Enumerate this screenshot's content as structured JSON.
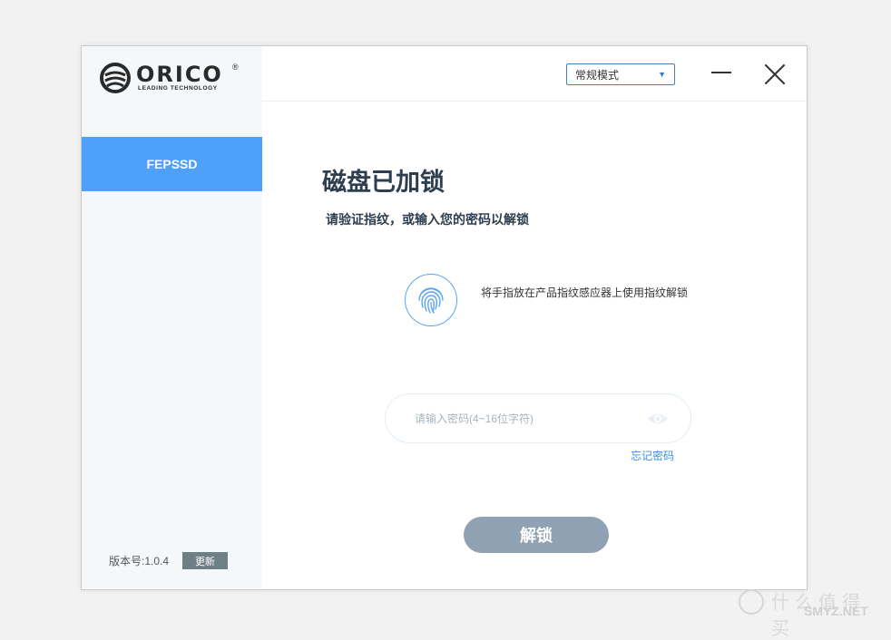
{
  "brand": {
    "name": "ORICO",
    "registered": "®",
    "tagline": "LEADING TECHNOLOGY"
  },
  "sidebar": {
    "items": [
      {
        "label": "FEPSSD"
      }
    ],
    "version_label": "版本号:1.0.4",
    "update_label": "更新"
  },
  "toolbar": {
    "mode_value": "常规模式",
    "mode_icon": "chevron-down-icon"
  },
  "main": {
    "title": "磁盘已加锁",
    "subtitle": "请验证指纹，或输入您的密码以解锁",
    "fingerprint_hint": "将手指放在产品指纹感应器上使用指纹解锁",
    "password_placeholder": "请输入密码(4~16位字符)",
    "password_value": "",
    "forgot_label": "忘记密码",
    "unlock_label": "解锁"
  },
  "watermark": {
    "top": "什么值得买",
    "bottom": "SMYZ.NET"
  },
  "colors": {
    "accent": "#4ea0f8",
    "sidebar_bg": "#f5f8fa",
    "title": "#2c3e50",
    "unlock_button": "#8fa1b3",
    "link": "#3a8ee6",
    "update_button": "#6f7f86"
  }
}
